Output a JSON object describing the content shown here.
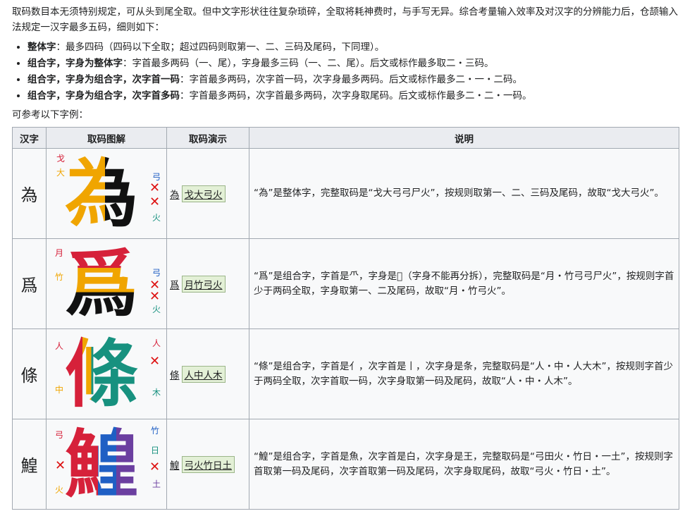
{
  "intro": "取码数目本无须特别规定，可从头到尾全取。但中文字形状往往复杂琐碎，全取将耗神费时，与手写无异。综合考量输入效率及对汉字的分辨能力后，仓颉输入法规定一汉字最多五码，细则如下：",
  "rules": [
    {
      "term": "整体字",
      "text": "：最多四码（四码以下全取；超过四码则取第一、二、三码及尾码，下同理）。"
    },
    {
      "term": "组合字，字身为整体字",
      "text": "：字首最多两码（一、尾），字身最多三码（一、二、尾）。后文或标作最多取二・三码。"
    },
    {
      "term": "组合字，字身为组合字，次字首一码",
      "text": "：字首最多两码，次字首一码，次字身最多两码。后文或标作最多二・一・二码。"
    },
    {
      "term": "组合字，字身为组合字，次字首多码",
      "text": "：字首最多两码，次字首最多两码，次字身取尾码。后文或标作最多二・二・一码。"
    }
  ],
  "ref_text": "可参考以下字例：",
  "table": {
    "headers": [
      "汉字",
      "取码图解",
      "取码演示",
      "说明"
    ],
    "rows": [
      {
        "han": "為",
        "demo_char": "為",
        "demo_code": "戈大弓火",
        "desc": "“為”是整体字，完整取码是“戈大弓弓尸火”，按规则取第一、二、三码及尾码，故取“戈大弓火”。",
        "labels": [
          "戈",
          "大",
          "弓",
          "火"
        ]
      },
      {
        "han": "爲",
        "demo_char": "爲",
        "demo_code": "月竹弓火",
        "desc": "“爲”是组合字，字首是⺥，字身是𤓰（字身不能再分拆），完整取码是“月・竹弓弓尸火”，按规则字首少于两码全取，字身取第一、二及尾码，故取“月・竹弓火”。",
        "labels": [
          "月",
          "竹",
          "弓",
          "火"
        ]
      },
      {
        "han": "條",
        "demo_char": "條",
        "demo_code": "人中人木",
        "desc": "“條”是组合字，字首是亻，次字首是丨，次字身是条，完整取码是“人・中・人大木”，按规则字首少于两码全取，次字首取一码，次字身取第一码及尾码，故取“人・中・人木”。",
        "labels": [
          "人",
          "人",
          "中",
          "木"
        ]
      },
      {
        "han": "鰉",
        "demo_char": "鰉",
        "demo_code": "弓火竹日土",
        "desc": "“鰉”是组合字，字首是魚，次字首是白，次字身是王，完整取码是“弓田火・竹日・一土”，按规则字首取第一码及尾码，次字首取第一码及尾码，次字身取尾码，故取“弓火・竹日・土”。",
        "labels": [
          "弓",
          "竹",
          "日",
          "火",
          "土"
        ]
      }
    ]
  },
  "colors": {
    "red": "#d6213a",
    "orange": "#f0a500",
    "blue": "#1f5fc4",
    "teal": "#17917f",
    "purple": "#6b3fa0",
    "cross": "#dd1111"
  }
}
